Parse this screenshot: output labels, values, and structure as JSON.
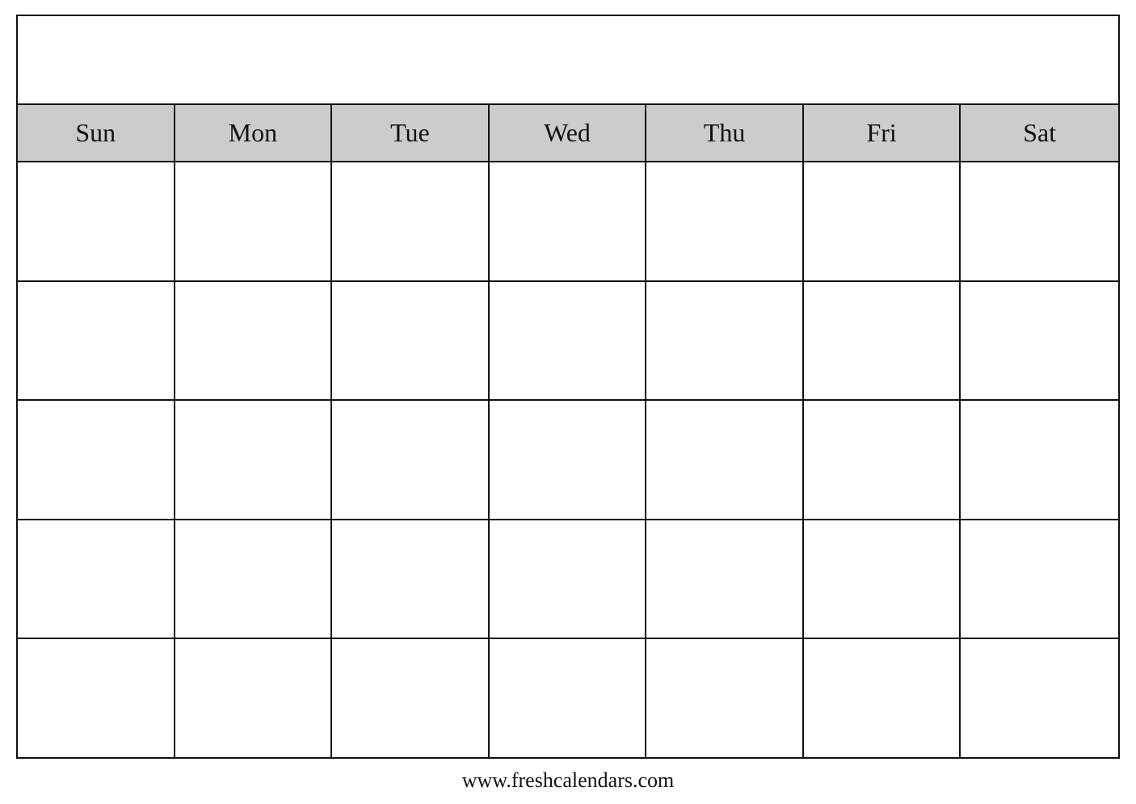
{
  "calendar": {
    "title": "",
    "days": [
      "Sun",
      "Mon",
      "Tue",
      "Wed",
      "Thu",
      "Fri",
      "Sat"
    ],
    "weeks": [
      [
        "",
        "",
        "",
        "",
        "",
        "",
        ""
      ],
      [
        "",
        "",
        "",
        "",
        "",
        "",
        ""
      ],
      [
        "",
        "",
        "",
        "",
        "",
        "",
        ""
      ],
      [
        "",
        "",
        "",
        "",
        "",
        "",
        ""
      ],
      [
        "",
        "",
        "",
        "",
        "",
        "",
        ""
      ]
    ],
    "footer": "www.freshcalendars.com"
  }
}
